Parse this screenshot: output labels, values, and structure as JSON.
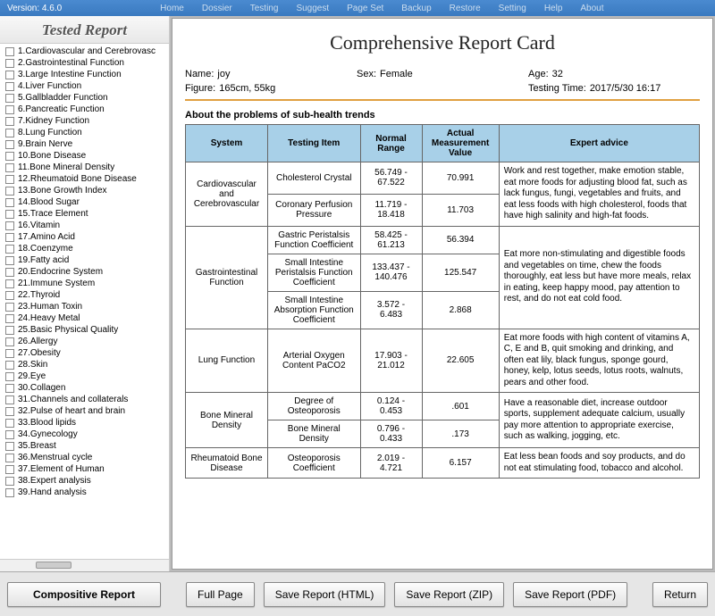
{
  "topbar": {
    "version": "Version: 4.6.0",
    "menu": [
      "Home",
      "Dossier",
      "Testing",
      "Suggest",
      "Page Set",
      "Backup",
      "Restore",
      "Setting",
      "Help",
      "About"
    ]
  },
  "sidebar": {
    "title": "Tested Report",
    "items": [
      "1.Cardiovascular and Cerebrovasc",
      "2.Gastrointestinal Function",
      "3.Large Intestine Function",
      "4.Liver Function",
      "5.Gallbladder Function",
      "6.Pancreatic Function",
      "7.Kidney Function",
      "8.Lung Function",
      "9.Brain Nerve",
      "10.Bone Disease",
      "11.Bone Mineral Density",
      "12.Rheumatoid Bone Disease",
      "13.Bone Growth Index",
      "14.Blood Sugar",
      "15.Trace Element",
      "16.Vitamin",
      "17.Amino Acid",
      "18.Coenzyme",
      "19.Fatty acid",
      "20.Endocrine System",
      "21.Immune System",
      "22.Thyroid",
      "23.Human Toxin",
      "24.Heavy Metal",
      "25.Basic Physical Quality",
      "26.Allergy",
      "27.Obesity",
      "28.Skin",
      "29.Eye",
      "30.Collagen",
      "31.Channels and collaterals",
      "32.Pulse of heart and brain",
      "33.Blood lipids",
      "34.Gynecology",
      "35.Breast",
      "36.Menstrual cycle",
      "37.Element of Human",
      "38.Expert analysis",
      "39.Hand analysis"
    ],
    "button": "Compositive Report"
  },
  "report": {
    "title": "Comprehensive Report Card",
    "name_label": "Name:",
    "name": "joy",
    "sex_label": "Sex:",
    "sex": "Female",
    "age_label": "Age:",
    "age": "32",
    "figure_label": "Figure:",
    "figure": "165cm, 55kg",
    "time_label": "Testing Time:",
    "time": "2017/5/30 16:17",
    "section_title": "About the problems of sub-health trends",
    "headers": [
      "System",
      "Testing Item",
      "Normal Range",
      "Actual Measurement Value",
      "Expert advice"
    ],
    "groups": [
      {
        "system": "Cardiovascular and Cerebrovascular",
        "rows": [
          {
            "item": "Cholesterol Crystal",
            "range": "56.749 - 67.522",
            "value": "70.991"
          },
          {
            "item": "Coronary Perfusion Pressure",
            "range": "11.719 - 18.418",
            "value": "11.703"
          }
        ],
        "advice": "Work and rest together, make emotion stable, eat more foods for adjusting blood fat, such as lack fungus, fungi, vegetables and fruits, and eat less foods with high cholesterol, foods that have high salinity and high-fat foods."
      },
      {
        "system": "Gastrointestinal Function",
        "rows": [
          {
            "item": "Gastric Peristalsis Function Coefficient",
            "range": "58.425 - 61.213",
            "value": "56.394"
          },
          {
            "item": "Small Intestine Peristalsis Function Coefficient",
            "range": "133.437 - 140.476",
            "value": "125.547"
          },
          {
            "item": "Small Intestine Absorption Function Coefficient",
            "range": "3.572 - 6.483",
            "value": "2.868"
          }
        ],
        "advice": "Eat more non-stimulating and digestible foods and vegetables on time, chew the foods thoroughly, eat less but have more meals, relax in eating, keep happy mood, pay attention to rest, and do not eat cold food."
      },
      {
        "system": "Lung Function",
        "rows": [
          {
            "item": "Arterial Oxygen Content PaCO2",
            "range": "17.903 - 21.012",
            "value": "22.605"
          }
        ],
        "advice": "Eat more foods with high content of vitamins A, C, E and B, quit smoking and drinking, and often eat lily, black fungus, sponge gourd, honey, kelp, lotus seeds, lotus roots, walnuts, pears and other food."
      },
      {
        "system": "Bone Mineral Density",
        "rows": [
          {
            "item": "Degree of Osteoporosis",
            "range": "0.124 - 0.453",
            "value": ".601"
          },
          {
            "item": "Bone Mineral Density",
            "range": "0.796 - 0.433",
            "value": ".173"
          }
        ],
        "advice": "Have a reasonable diet, increase outdoor sports, supplement adequate calcium, usually pay more attention to appropriate exercise, such as walking, jogging, etc."
      },
      {
        "system": "Rheumatoid Bone Disease",
        "rows": [
          {
            "item": "Osteoporosis Coefficient",
            "range": "2.019 - 4.721",
            "value": "6.157"
          }
        ],
        "advice": "Eat less bean foods and soy products, and do not eat stimulating food, tobacco and alcohol."
      }
    ]
  },
  "buttons": {
    "full_page": "Full Page",
    "save_html": "Save Report (HTML)",
    "save_zip": "Save Report (ZIP)",
    "save_pdf": "Save Report (PDF)",
    "return": "Return"
  }
}
